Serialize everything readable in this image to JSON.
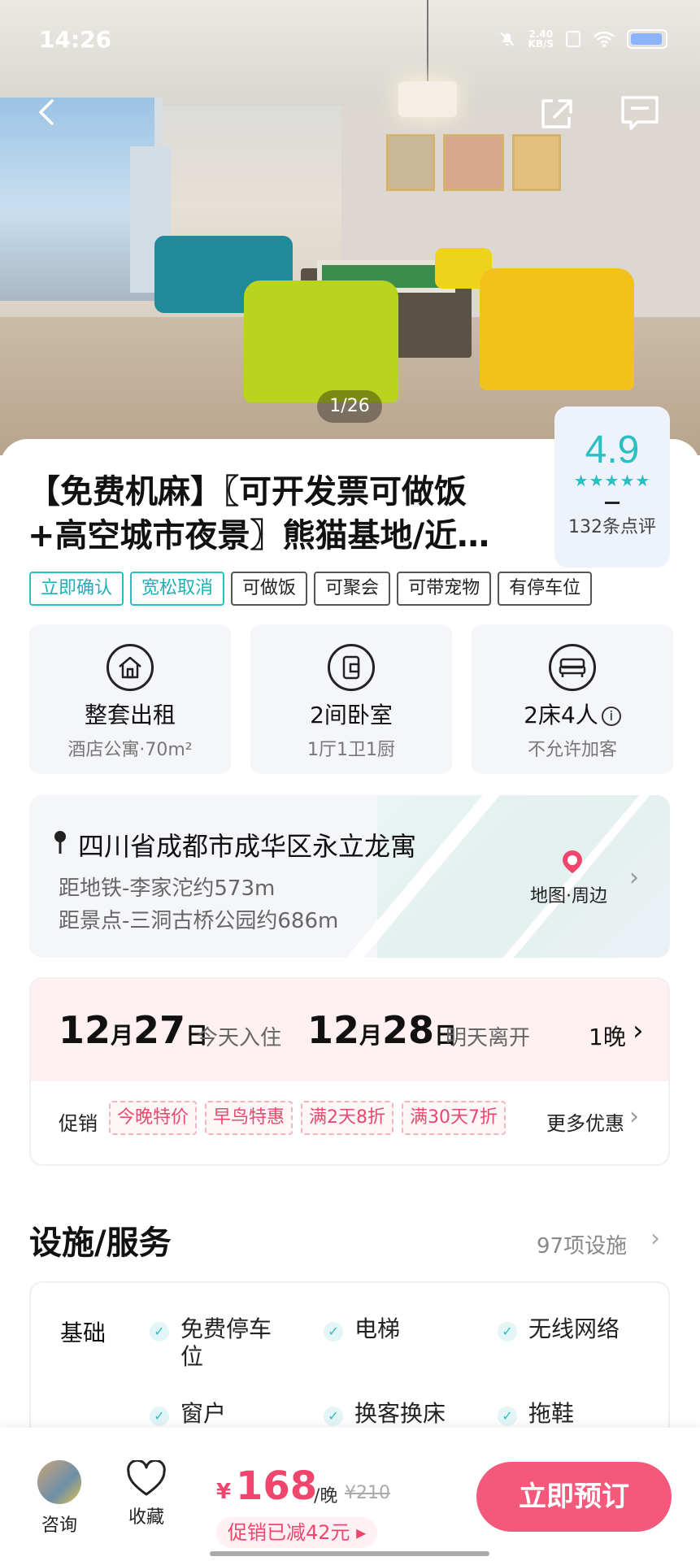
{
  "status_bar": {
    "time": "14:26",
    "net_speed": "2.40",
    "net_unit": "KB/S"
  },
  "gallery": {
    "counter": "1/26"
  },
  "listing": {
    "title_line1": "【免费机麻】〖可开发票可做饭",
    "title_line2": "+高空城市夜景〗熊猫基地/近…",
    "rating": {
      "score": "4.9",
      "stars": "★★★★★",
      "reviews": "132条点评"
    },
    "tags": [
      {
        "label": "立即确认",
        "style": "teal"
      },
      {
        "label": "宽松取消",
        "style": "teal"
      },
      {
        "label": "可做饭",
        "style": "plain"
      },
      {
        "label": "可聚会",
        "style": "plain"
      },
      {
        "label": "可带宠物",
        "style": "plain"
      },
      {
        "label": "有停车位",
        "style": "plain"
      }
    ]
  },
  "specs": [
    {
      "icon": "house-icon",
      "main": "整套出租",
      "sub": "酒店公寓·70m²"
    },
    {
      "icon": "door-icon",
      "main": "2间卧室",
      "sub": "1厅1卫1厨"
    },
    {
      "icon": "bed-icon",
      "main": "2床4人",
      "sub": "不允许加客"
    }
  ],
  "address": {
    "line": "四川省成都市成华区永立龙寓",
    "metro": "距地铁-李家沱约573m",
    "sight": "距景点-三洞古桥公园约686m",
    "map_label": "地图·周边"
  },
  "dates": {
    "checkin_month": "12",
    "checkin_day": "27",
    "month_char": "月",
    "day_char": "日",
    "checkin_label": "今天入住",
    "checkout_month": "12",
    "checkout_day": "28",
    "checkout_label": "明天离开",
    "nights": "1晚",
    "promo_label": "促销",
    "promos": [
      "今晚特价",
      "早鸟特惠",
      "满2天8折",
      "满30天7折"
    ],
    "more_promos": "更多优惠"
  },
  "facilities": {
    "title": "设施/服务",
    "count": "97项设施",
    "category": "基础",
    "items": [
      "免费停车位",
      "电梯",
      "无线网络",
      "窗户",
      "换客换床",
      "拖鞋"
    ]
  },
  "bottom": {
    "consult": "咨询",
    "favorite": "收藏",
    "currency": "¥",
    "price": "168",
    "unit": "/晚",
    "original": "¥210",
    "discount": "促销已减42元",
    "book": "立即预订"
  },
  "colors": {
    "accent_teal": "#2abfc2",
    "accent_pink": "#f0466e",
    "book_button": "#f4587a"
  }
}
